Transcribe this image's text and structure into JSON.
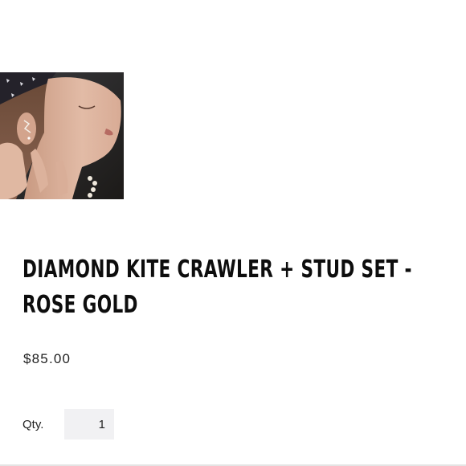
{
  "product": {
    "image_alt": "Model wearing diamond kite crawler earring",
    "title_line1": "DIAMOND KITE CRAWLER + STUD SET -",
    "title_line2": "ROSE GOLD",
    "price": "$85.00"
  },
  "quantity": {
    "label": "Qty.",
    "value": "1"
  },
  "colors": {
    "text": "#0d0d0d",
    "qty_bg": "#f1f1f3"
  }
}
